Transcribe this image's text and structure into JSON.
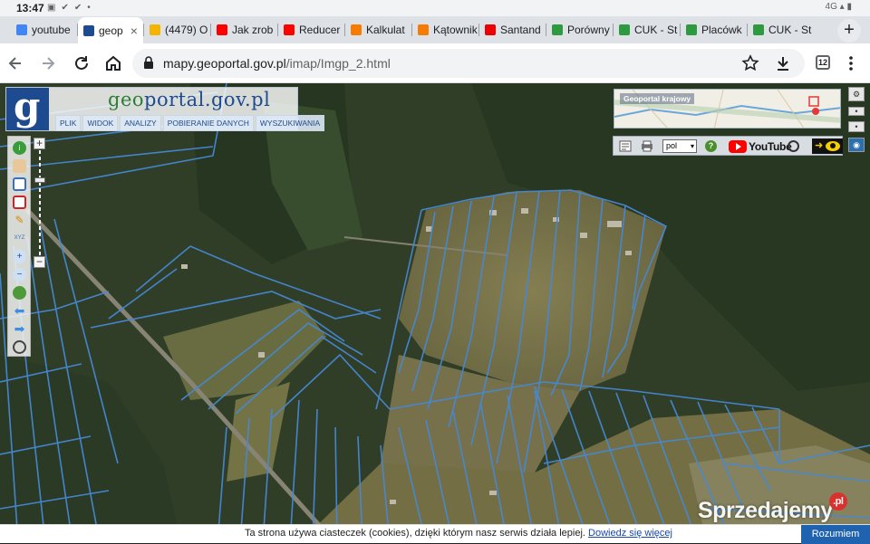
{
  "status_bar": {
    "time": "13:47",
    "network": "4G"
  },
  "tabs": [
    {
      "title": "youtube",
      "favicon": "google-icon",
      "color": "#4285f4"
    },
    {
      "title": "geop",
      "favicon": "geoportal-icon",
      "color": "#1e4b8f",
      "active": true
    },
    {
      "title": "(4479) O",
      "favicon": "mail-icon",
      "color": "#f4b400"
    },
    {
      "title": "Jak zrob",
      "favicon": "youtube-icon",
      "color": "#ff0000"
    },
    {
      "title": "Reducer",
      "favicon": "youtube-icon",
      "color": "#ff0000"
    },
    {
      "title": "Kalkulat",
      "favicon": "m-icon",
      "color": "#f57c00"
    },
    {
      "title": "Kątownik",
      "favicon": "a-icon",
      "color": "#f57c00"
    },
    {
      "title": "Santand",
      "favicon": "santander-icon",
      "color": "#ec0000"
    },
    {
      "title": "Porówny",
      "favicon": "leaf-icon",
      "color": "#2e9a3f"
    },
    {
      "title": "CUK - St",
      "favicon": "leaf-icon",
      "color": "#2e9a3f"
    },
    {
      "title": "Placówk",
      "favicon": "leaf-icon",
      "color": "#2e9a3f"
    },
    {
      "title": "CUK - St",
      "favicon": "leaf-icon",
      "color": "#2e9a3f"
    }
  ],
  "toolbar": {
    "url_host": "mapy.geoportal.gov.pl",
    "url_path": "/imap/Imgp_2.html",
    "tab_count": "12"
  },
  "geoportal": {
    "title_prefix": "geo",
    "title_rest": "portal.gov.pl",
    "logo_letter": "g",
    "menu": [
      "PLIK",
      "WIDOK",
      "ANALIZY",
      "POBIERANIE DANYCH",
      "WYSZUKIWANIA"
    ],
    "overview_label": "Geoportal krajowy",
    "language": "pol",
    "youtube_label": "YouTube"
  },
  "cookie": {
    "text": "Ta strona używa ciasteczek (cookies), dzięki którym nasz serwis działa lepiej.",
    "link": "Dowiedz się więcej",
    "accept": "Rozumiem"
  },
  "watermark": {
    "text": "Sprzedajemy",
    "badge": ".pl"
  },
  "colors": {
    "parcel_line": "#4a90e2",
    "accent": "#1e4b8f"
  }
}
